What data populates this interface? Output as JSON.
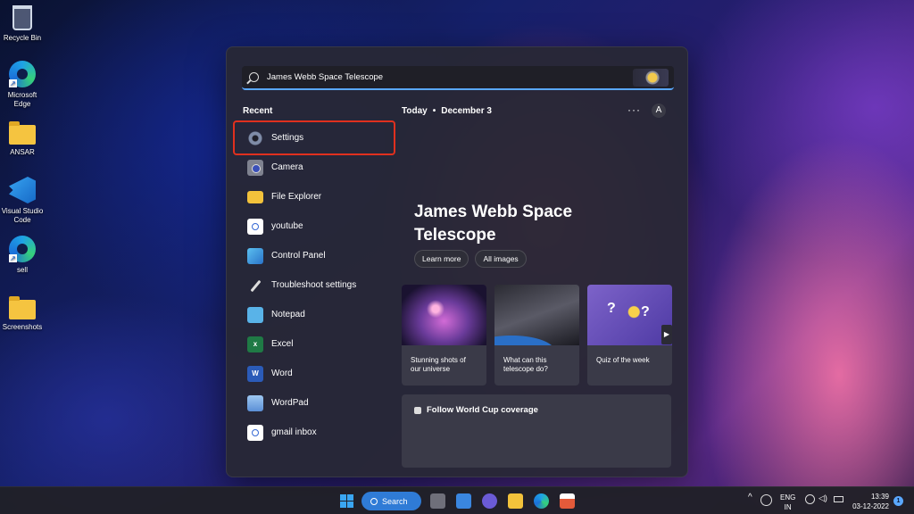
{
  "desktop": {
    "icons": [
      {
        "label": "Recycle Bin",
        "icon": "recycle-bin-icon"
      },
      {
        "label": "Microsoft Edge",
        "icon": "edge-icon"
      },
      {
        "label": "ANSAR",
        "icon": "folder-icon"
      },
      {
        "label": "Visual Studio Code",
        "icon": "vscode-icon"
      },
      {
        "label": "sell",
        "icon": "edge-icon"
      },
      {
        "label": "Screenshots",
        "icon": "folder-icon"
      }
    ]
  },
  "search": {
    "query": "James Webb Space Telescope"
  },
  "recent": {
    "title": "Recent",
    "items": [
      {
        "label": "Settings",
        "icon": "gear-icon"
      },
      {
        "label": "Camera",
        "icon": "camera-icon"
      },
      {
        "label": "File Explorer",
        "icon": "folder-icon"
      },
      {
        "label": "youtube",
        "icon": "search-result-icon"
      },
      {
        "label": "Control Panel",
        "icon": "control-panel-icon"
      },
      {
        "label": "Troubleshoot settings",
        "icon": "wrench-icon"
      },
      {
        "label": "Notepad",
        "icon": "notepad-icon"
      },
      {
        "label": "Excel",
        "icon": "excel-icon"
      },
      {
        "label": "Word",
        "icon": "word-icon"
      },
      {
        "label": "WordPad",
        "icon": "wordpad-icon"
      },
      {
        "label": "gmail inbox",
        "icon": "search-result-icon"
      }
    ]
  },
  "highlights": {
    "today_label": "Today",
    "date": "December 3",
    "more": "···",
    "avatar_initial": "A",
    "hero_title": "James Webb Space Telescope",
    "buttons": {
      "learn_more": "Learn more",
      "all_images": "All images"
    },
    "cards": [
      {
        "caption": "Stunning shots of our universe"
      },
      {
        "caption": "What can this telescope do?"
      },
      {
        "caption": "Quiz of the week"
      }
    ],
    "next_arrow": "▶",
    "world_cup": "Follow World Cup coverage"
  },
  "taskbar": {
    "search_label": "Search",
    "lang_top": "ENG",
    "lang_bottom": "IN",
    "time": "13:39",
    "date": "03-12-2022",
    "notification_count": "1"
  },
  "colors": {
    "accent": "#2f7bd6",
    "selection_outline": "#e0301e",
    "search_underline": "#5aa8ff"
  }
}
